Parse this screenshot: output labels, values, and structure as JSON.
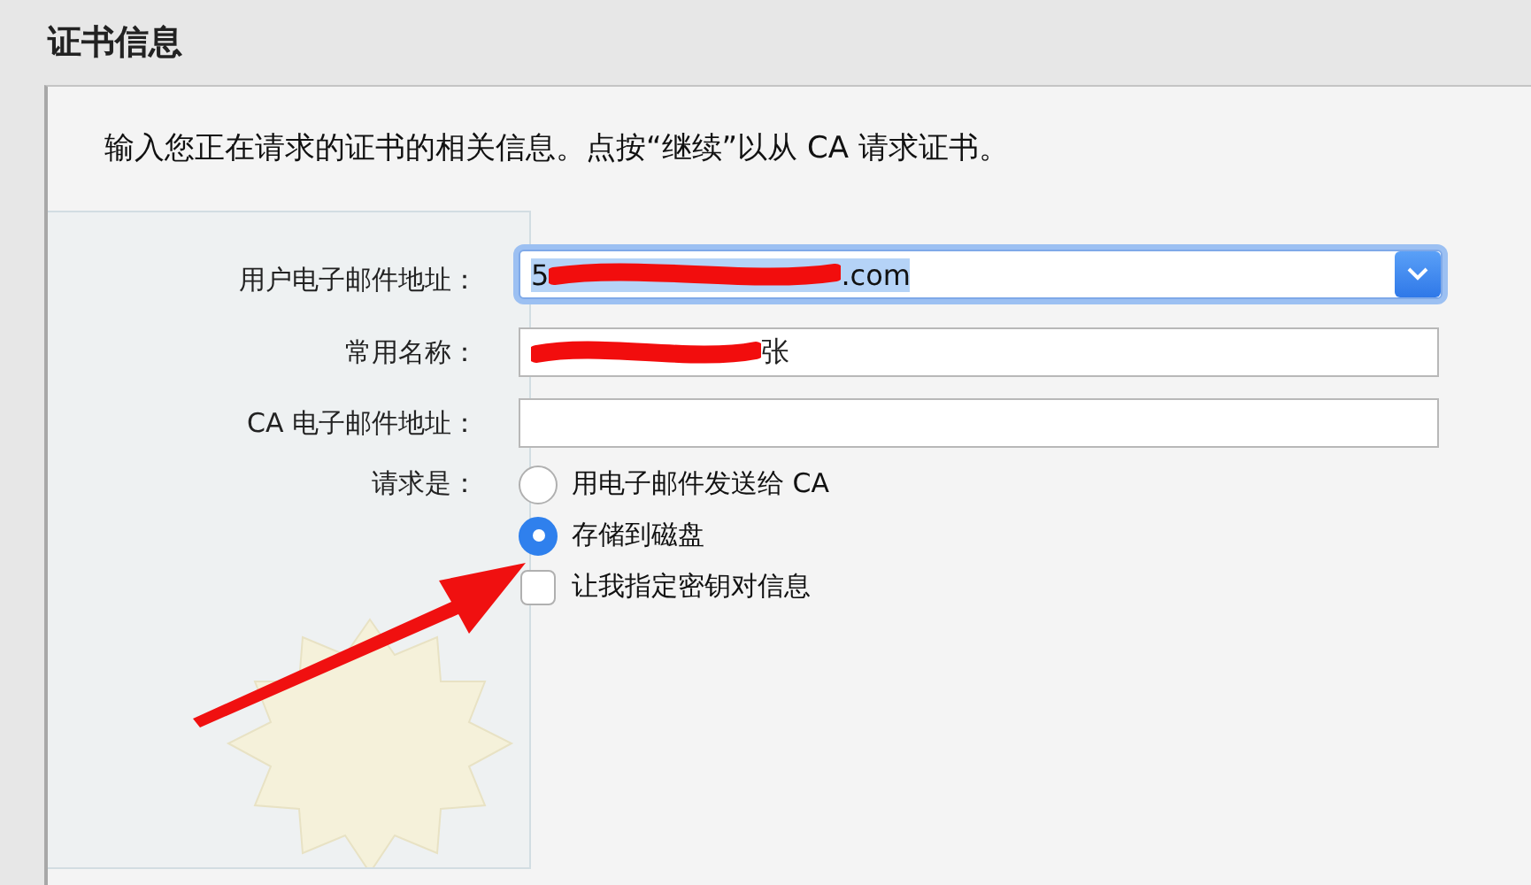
{
  "title": "证书信息",
  "intro": "输入您正在请求的证书的相关信息。点按“继续”以从 CA 请求证书。",
  "fields": [
    {
      "kind": "select",
      "label": "用户电子邮件地址：",
      "value_start": "5",
      "value_end": ".com",
      "redacted": true
    },
    {
      "kind": "text",
      "label": "常用名称：",
      "value_end": "张",
      "redacted": true
    },
    {
      "kind": "text",
      "label": "CA 电子邮件地址："
    }
  ],
  "request": {
    "label": "请求是：",
    "options": [
      {
        "label": "用电子邮件发送给 CA",
        "selected": false
      },
      {
        "label": "存储到磁盘",
        "selected": true
      }
    ],
    "checkbox": {
      "label": "让我指定密钥对信息",
      "checked": false
    }
  },
  "annotation": {
    "kind": "arrow"
  }
}
